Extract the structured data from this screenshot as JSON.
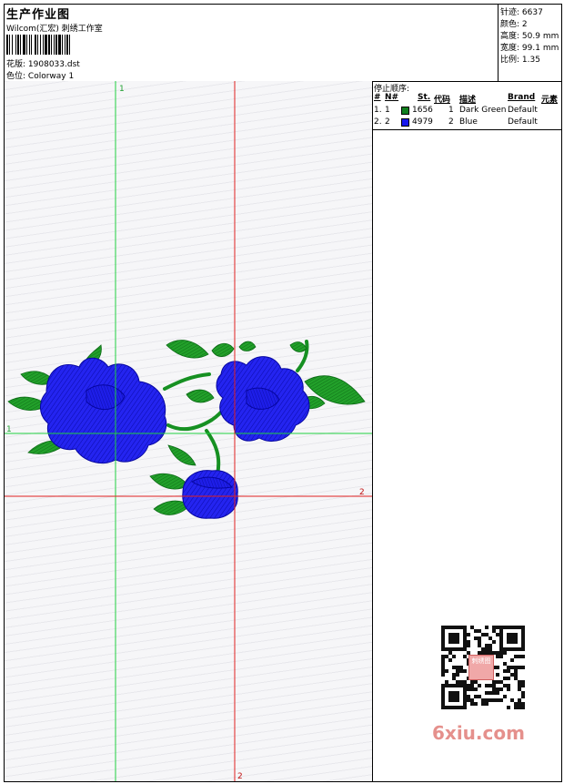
{
  "header": {
    "title": "生产作业图",
    "studio": "Wilcom(汇宏) 刺绣工作室",
    "design_label": "花版:",
    "design_file": "1908033.dst",
    "colorway_label": "色位:",
    "colorway": "Colorway 1"
  },
  "stats": {
    "stitches_label": "针迹:",
    "stitches": "6637",
    "colors_label": "颜色:",
    "colors": "2",
    "height_label": "高度:",
    "height": "50.9 mm",
    "width_label": "宽度:",
    "width": "99.1 mm",
    "scale_label": "比例:",
    "scale": "1.35"
  },
  "stop_sequence": {
    "title": "停止顺序:",
    "columns": [
      "#",
      "N#",
      "St.",
      "代码",
      "描述",
      "Brand",
      "元素"
    ],
    "rows": [
      {
        "seq": "1.",
        "needle": "1",
        "color": "#0f7f1e",
        "stitches": "1656",
        "code": "1",
        "desc": "Dark Green",
        "brand": "Default"
      },
      {
        "seq": "2.",
        "needle": "2",
        "color": "#1818ee",
        "stitches": "4979",
        "code": "2",
        "desc": "Blue",
        "brand": "Default"
      }
    ]
  },
  "guides": {
    "v1": "1",
    "h1": "1",
    "v2": "2",
    "h2": "2",
    "green": "#20d040",
    "red": "#e02020"
  },
  "watermark": "6xiu.com",
  "qr_badge_text": "刺绣图"
}
